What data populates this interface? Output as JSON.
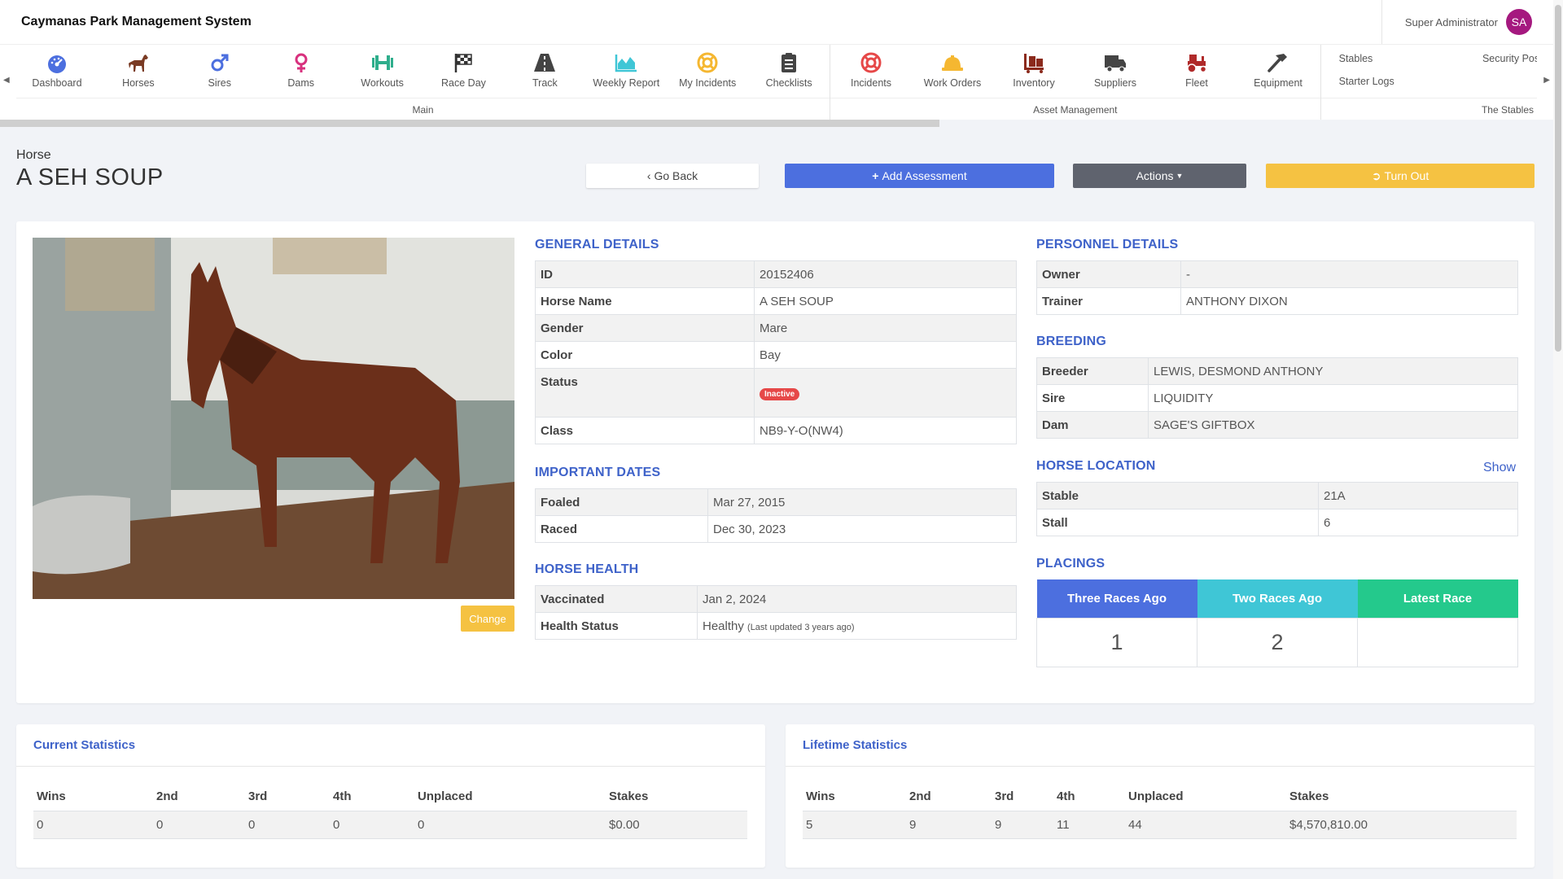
{
  "app": {
    "title": "Caymanas Park Management System"
  },
  "user": {
    "name": "Super Administrator",
    "initials": "SA"
  },
  "ribbon": {
    "main_label": "Main",
    "asset_label": "Asset Management",
    "stables_label": "The Stables",
    "main_items": [
      {
        "label": "Dashboard",
        "icon": "dashboard-icon"
      },
      {
        "label": "Horses",
        "icon": "horse-icon"
      },
      {
        "label": "Sires",
        "icon": "male-icon"
      },
      {
        "label": "Dams",
        "icon": "female-icon"
      },
      {
        "label": "Workouts",
        "icon": "dumbbell-icon"
      },
      {
        "label": "Race Day",
        "icon": "checkered-flag-icon"
      },
      {
        "label": "Track",
        "icon": "road-icon"
      },
      {
        "label": "Weekly Report",
        "icon": "area-chart-icon"
      },
      {
        "label": "My Incidents",
        "icon": "life-ring-icon"
      },
      {
        "label": "Checklists",
        "icon": "clipboard-icon"
      }
    ],
    "asset_items": [
      {
        "label": "Incidents",
        "icon": "life-ring-icon"
      },
      {
        "label": "Work Orders",
        "icon": "hard-hat-icon"
      },
      {
        "label": "Inventory",
        "icon": "dolly-icon"
      },
      {
        "label": "Suppliers",
        "icon": "truck-icon"
      },
      {
        "label": "Fleet",
        "icon": "tractor-icon"
      },
      {
        "label": "Equipment",
        "icon": "hammer-icon"
      }
    ],
    "stables_items": {
      "stables": "Stables",
      "security_post": "Security Post",
      "starter_logs": "Starter Logs"
    }
  },
  "header": {
    "breadcrumb": "Horse",
    "title": "A SEH SOUP",
    "go_back": "Go Back",
    "add_assessment": "Add Assessment",
    "actions": "Actions",
    "turn_out": "Turn Out"
  },
  "photo": {
    "change_label": "Change"
  },
  "general": {
    "title": "GENERAL DETAILS",
    "id_label": "ID",
    "id": "20152406",
    "name_label": "Horse Name",
    "name": "A SEH SOUP",
    "gender_label": "Gender",
    "gender": "Mare",
    "color_label": "Color",
    "color": "Bay",
    "status_label": "Status",
    "status": "Inactive",
    "class_label": "Class",
    "class": "NB9-Y-O(NW4)"
  },
  "dates": {
    "title": "IMPORTANT DATES",
    "foaled_label": "Foaled",
    "foaled": "Mar 27, 2015",
    "raced_label": "Raced",
    "raced": "Dec 30, 2023"
  },
  "health": {
    "title": "HORSE HEALTH",
    "vaccinated_label": "Vaccinated",
    "vaccinated": "Jan 2, 2024",
    "status_label": "Health Status",
    "status": "Healthy",
    "note": "(Last updated 3 years ago)"
  },
  "personnel": {
    "title": "PERSONNEL DETAILS",
    "owner_label": "Owner",
    "owner": "-",
    "trainer_label": "Trainer",
    "trainer": "ANTHONY DIXON"
  },
  "breeding": {
    "title": "BREEDING",
    "breeder_label": "Breeder",
    "breeder": "LEWIS, DESMOND ANTHONY",
    "sire_label": "Sire",
    "sire": "LIQUIDITY",
    "dam_label": "Dam",
    "dam": "SAGE'S GIFTBOX"
  },
  "location": {
    "title": "HORSE LOCATION",
    "show_label": "Show",
    "stable_label": "Stable",
    "stable": "21A",
    "stall_label": "Stall",
    "stall": "6"
  },
  "placings": {
    "title": "PLACINGS",
    "headers": [
      "Three Races Ago",
      "Two Races Ago",
      "Latest Race"
    ],
    "values": [
      "1",
      "2",
      ""
    ],
    "colors": [
      "#4c6fdf",
      "#3fc6d6",
      "#24c98c"
    ]
  },
  "current_stats": {
    "title": "Current Statistics",
    "headers": [
      "Wins",
      "2nd",
      "3rd",
      "4th",
      "Unplaced",
      "Stakes"
    ],
    "values": [
      "0",
      "0",
      "0",
      "0",
      "0",
      "$0.00"
    ]
  },
  "lifetime_stats": {
    "title": "Lifetime Statistics",
    "headers": [
      "Wins",
      "2nd",
      "3rd",
      "4th",
      "Unplaced",
      "Stakes"
    ],
    "values": [
      "5",
      "9",
      "9",
      "11",
      "44",
      "$4,570,810.00"
    ]
  },
  "colors": {
    "primary": "#4c6fdf",
    "secondary": "#5f636e",
    "warning": "#f5c242",
    "danger": "#e64848",
    "heading": "#3e62c9",
    "avatar": "#a5197f"
  }
}
